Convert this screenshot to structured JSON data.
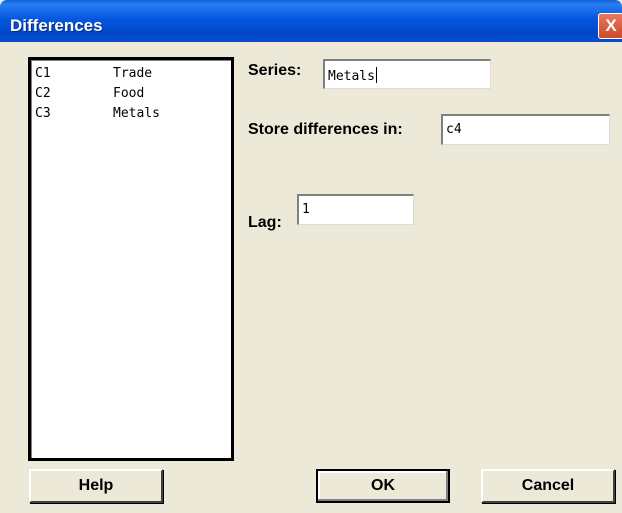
{
  "window": {
    "title": "Differences",
    "close_glyph": "X",
    "close_icon": "close-icon"
  },
  "variables": [
    {
      "column": "C1",
      "name": "Trade"
    },
    {
      "column": "C2",
      "name": "Food"
    },
    {
      "column": "C3",
      "name": "Metals"
    }
  ],
  "form": {
    "series_label": "Series:",
    "series_value": "Metals",
    "store_label": "Store differences in:",
    "store_value": "c4",
    "lag_label": "Lag:",
    "lag_value": "1"
  },
  "buttons": {
    "help": "Help",
    "ok": "OK",
    "cancel": "Cancel"
  },
  "colors": {
    "titlebar": "#0046c8",
    "dialog_bg": "#ece9d8",
    "close_button": "#c94a2a"
  }
}
